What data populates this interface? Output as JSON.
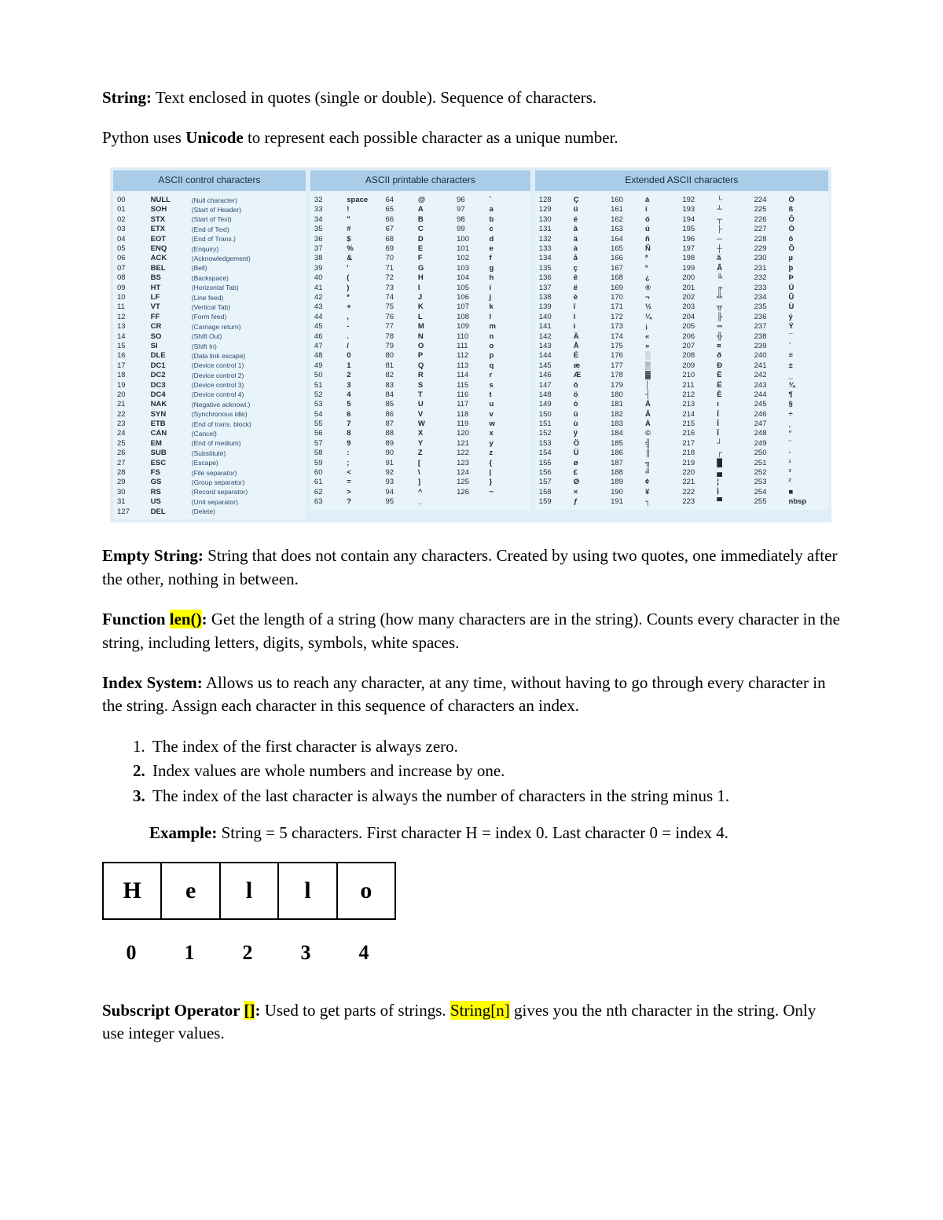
{
  "p1": {
    "term": "String:",
    "text": " Text enclosed in quotes (single or double). Sequence of characters."
  },
  "p2": {
    "pre": "Python uses ",
    "bold": "Unicode",
    "post": " to represent each possible character as a unique number."
  },
  "ascii": {
    "control": {
      "header": "ASCII control\ncharacters",
      "rows": [
        [
          "00",
          "NULL",
          "(Null character)"
        ],
        [
          "01",
          "SOH",
          "(Start of Header)"
        ],
        [
          "02",
          "STX",
          "(Start of Text)"
        ],
        [
          "03",
          "ETX",
          "(End of Text)"
        ],
        [
          "04",
          "EOT",
          "(End of Trans.)"
        ],
        [
          "05",
          "ENQ",
          "(Enquiry)"
        ],
        [
          "06",
          "ACK",
          "(Acknowledgement)"
        ],
        [
          "07",
          "BEL",
          "(Bell)"
        ],
        [
          "08",
          "BS",
          "(Backspace)"
        ],
        [
          "09",
          "HT",
          "(Horizontal Tab)"
        ],
        [
          "10",
          "LF",
          "(Line feed)"
        ],
        [
          "11",
          "VT",
          "(Vertical Tab)"
        ],
        [
          "12",
          "FF",
          "(Form feed)"
        ],
        [
          "13",
          "CR",
          "(Carriage return)"
        ],
        [
          "14",
          "SO",
          "(Shift Out)"
        ],
        [
          "15",
          "SI",
          "(Shift In)"
        ],
        [
          "16",
          "DLE",
          "(Data link escape)"
        ],
        [
          "17",
          "DC1",
          "(Device control 1)"
        ],
        [
          "18",
          "DC2",
          "(Device control 2)"
        ],
        [
          "19",
          "DC3",
          "(Device control 3)"
        ],
        [
          "20",
          "DC4",
          "(Device control 4)"
        ],
        [
          "21",
          "NAK",
          "(Negative acknowl.)"
        ],
        [
          "22",
          "SYN",
          "(Synchronous idle)"
        ],
        [
          "23",
          "ETB",
          "(End of trans. block)"
        ],
        [
          "24",
          "CAN",
          "(Cancel)"
        ],
        [
          "25",
          "EM",
          "(End of medium)"
        ],
        [
          "26",
          "SUB",
          "(Substitute)"
        ],
        [
          "27",
          "ESC",
          "(Escape)"
        ],
        [
          "28",
          "FS",
          "(File separator)"
        ],
        [
          "29",
          "GS",
          "(Group separator)"
        ],
        [
          "30",
          "RS",
          "(Record separator)"
        ],
        [
          "31",
          "US",
          "(Unit separator)"
        ],
        [
          "127",
          "DEL",
          "(Delete)"
        ]
      ]
    },
    "printable": {
      "header": "ASCII printable\ncharacters",
      "start": 32,
      "items": [
        "space",
        "!",
        "\"",
        "#",
        "$",
        "%",
        "&",
        "'",
        "(",
        ")",
        "*",
        "+",
        ",",
        "-",
        ".",
        "/",
        "0",
        "1",
        "2",
        "3",
        "4",
        "5",
        "6",
        "7",
        "8",
        "9",
        ":",
        ";",
        "<",
        "=",
        ">",
        "?",
        "@",
        "A",
        "B",
        "C",
        "D",
        "E",
        "F",
        "G",
        "H",
        "I",
        "J",
        "K",
        "L",
        "M",
        "N",
        "O",
        "P",
        "Q",
        "R",
        "S",
        "T",
        "U",
        "V",
        "W",
        "X",
        "Y",
        "Z",
        "[",
        "\\",
        "]",
        "^",
        "_",
        "`",
        "a",
        "b",
        "c",
        "d",
        "e",
        "f",
        "g",
        "h",
        "i",
        "j",
        "k",
        "l",
        "m",
        "n",
        "o",
        "p",
        "q",
        "r",
        "s",
        "t",
        "u",
        "v",
        "w",
        "x",
        "y",
        "z",
        "{",
        "|",
        "}",
        "~"
      ]
    },
    "extended": {
      "header": "Extended ASCII\ncharacters",
      "start": 128,
      "items": [
        "Ç",
        "ü",
        "é",
        "â",
        "ä",
        "à",
        "å",
        "ç",
        "ê",
        "ë",
        "è",
        "ï",
        "î",
        "ì",
        "Ä",
        "Å",
        "É",
        "æ",
        "Æ",
        "ô",
        "ö",
        "ò",
        "û",
        "ù",
        "ÿ",
        "Ö",
        "Ü",
        "ø",
        "£",
        "Ø",
        "×",
        "ƒ",
        "á",
        "í",
        "ó",
        "ú",
        "ñ",
        "Ñ",
        "ª",
        "º",
        "¿",
        "®",
        "¬",
        "½",
        "¼",
        "¡",
        "«",
        "»",
        "░",
        "▒",
        "▓",
        "│",
        "┤",
        "Á",
        "Â",
        "À",
        "©",
        "╣",
        "║",
        "╗",
        "╝",
        "¢",
        "¥",
        "┐",
        "└",
        "┴",
        "┬",
        "├",
        "─",
        "┼",
        "ã",
        "Ã",
        "╚",
        "╔",
        "╩",
        "╦",
        "╠",
        "═",
        "╬",
        "¤",
        "ð",
        "Ð",
        "Ê",
        "Ë",
        "È",
        "ı",
        "Í",
        "Î",
        "Ï",
        "┘",
        "┌",
        "█",
        "▄",
        "¦",
        "Ì",
        "▀",
        "Ó",
        "ß",
        "Ô",
        "Ò",
        "õ",
        "Õ",
        "µ",
        "þ",
        "Þ",
        "Ú",
        "Û",
        "Ù",
        "ý",
        "Ý",
        "¯",
        "´",
        "≡",
        "±",
        "‗",
        "¾",
        "¶",
        "§",
        "÷",
        "¸",
        "°",
        "¨",
        "·",
        "¹",
        "³",
        "²",
        "■",
        "nbsp"
      ]
    }
  },
  "p3": {
    "term": "Empty String:",
    "text": " String that does not contain any characters. Created by using two quotes, one immediately after the other, nothing in between."
  },
  "p4": {
    "term": "Function ",
    "hl": "len()",
    "colon": ":",
    "text": " Get the length of a string (how many characters are in the string). Counts every character in the string, including letters, digits, symbols, white spaces."
  },
  "p5": {
    "term": "Index System:",
    "text": " Allows us to reach any character, at any time, without having to go through every character in the string. Assign each character in this sequence of characters an index."
  },
  "indexList": [
    "The index of the first character is always zero.",
    "Index values are whole numbers and increase by one.",
    "The index of the last character is always the number of characters in the string minus 1."
  ],
  "example": {
    "label": "Example:",
    "text": " String = 5 characters. First character H = index 0. Last character 0 = index 4."
  },
  "hello": {
    "chars": [
      "H",
      "e",
      "l",
      "l",
      "o"
    ],
    "idx": [
      "0",
      "1",
      "2",
      "3",
      "4"
    ]
  },
  "p6": {
    "term": "Subscript Operator ",
    "hl1": "[]",
    "colon": ":",
    "text1": " Used to get parts of strings. ",
    "hl2": "String[n]",
    "text2": " gives you the nth character in the string. Only use integer values."
  }
}
